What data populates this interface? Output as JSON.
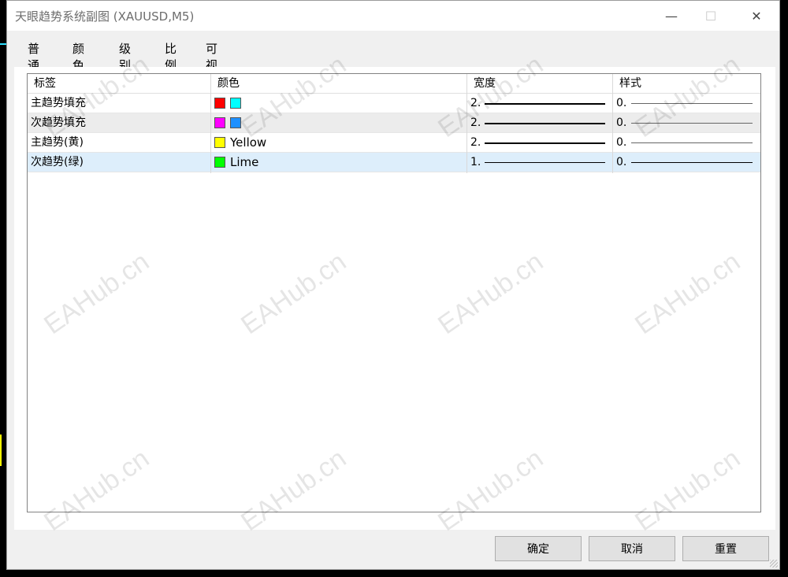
{
  "window": {
    "title": "天眼趋势系统副图 (XAUUSD,M5)"
  },
  "controls": {
    "minimize": "—",
    "maximize": "☐",
    "close": "✕"
  },
  "tabs": [
    {
      "label": "普通"
    },
    {
      "label": "颜色"
    },
    {
      "label": "级别"
    },
    {
      "label": "比例"
    },
    {
      "label": "可视化"
    }
  ],
  "active_tab": "颜色",
  "table": {
    "headers": {
      "label": "标签",
      "color": "颜色",
      "width": "宽度",
      "style": "样式"
    },
    "rows": [
      {
        "label": "主趋势填充",
        "swatches": [
          "#ff0000",
          "#00ffff"
        ],
        "color_name": "",
        "width": "2.",
        "style": "0."
      },
      {
        "label": "次趋势填充",
        "swatches": [
          "#ff00ff",
          "#1e90ff"
        ],
        "color_name": "",
        "width": "2.",
        "style": "0."
      },
      {
        "label": "主趋势(黄)",
        "swatches": [
          "#ffff00"
        ],
        "color_name": "Yellow",
        "width": "2.",
        "style": "0."
      },
      {
        "label": "次趋势(绿)",
        "swatches": [
          "#00ff00"
        ],
        "color_name": "Lime",
        "width": "1.",
        "style": "0."
      }
    ]
  },
  "buttons": {
    "ok": "确定",
    "cancel": "取消",
    "reset": "重置"
  },
  "watermark": "EAHub.cn",
  "colors": {
    "accent": "#0a64c8",
    "selected_row": "#ddeefb",
    "alt_row": "#ececec"
  }
}
